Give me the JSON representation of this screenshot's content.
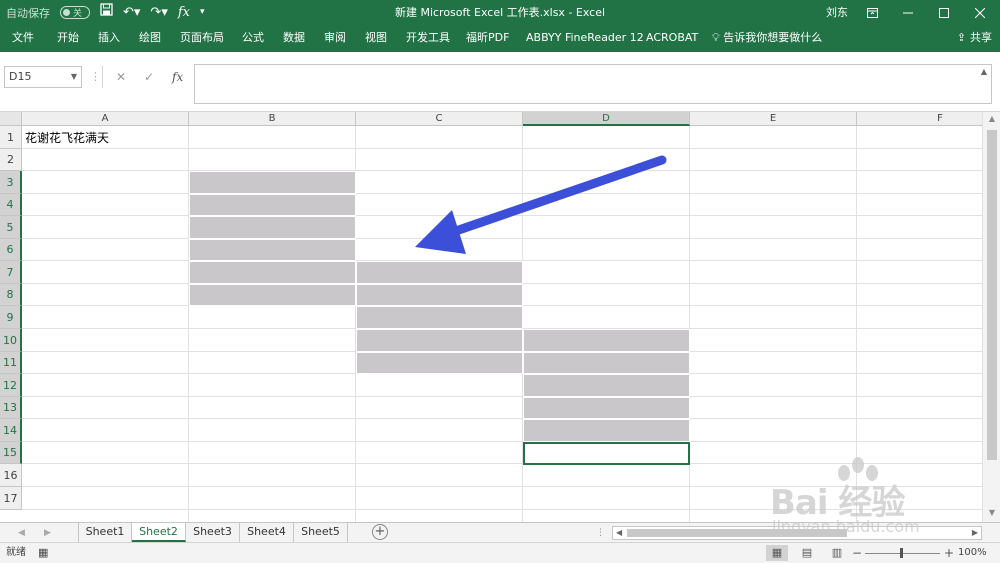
{
  "titlebar": {
    "autosave_label": "自动保存",
    "autosave_state": "关",
    "title": "新建 Microsoft Excel 工作表.xlsx  -  Excel",
    "user": "刘东"
  },
  "ribbon": {
    "tabs": [
      "文件",
      "开始",
      "插入",
      "绘图",
      "页面布局",
      "公式",
      "数据",
      "审阅",
      "视图",
      "开发工具",
      "福昕PDF",
      "ABBYY FineReader 12",
      "ACROBAT"
    ],
    "tell_me": "告诉我你想要做什么",
    "share": "共享"
  },
  "formula_bar": {
    "name_box": "D15",
    "fx_label": "fx",
    "formula": ""
  },
  "grid": {
    "columns": [
      "A",
      "B",
      "C",
      "D",
      "E",
      "F"
    ],
    "selected_column": "D",
    "rows": [
      "1",
      "2",
      "3",
      "4",
      "5",
      "6",
      "7",
      "8",
      "9",
      "10",
      "11",
      "12",
      "13",
      "14",
      "15",
      "16",
      "17"
    ],
    "selected_rows": [
      "3",
      "4",
      "5",
      "6",
      "7",
      "8",
      "9",
      "10",
      "11",
      "12",
      "13",
      "14",
      "15"
    ],
    "cell_a1": "花谢花飞花满天",
    "shaded_fill": "#c9c7ca",
    "active_cell": "D15",
    "arrow_color": "#3b4fd8"
  },
  "sheets": {
    "tabs": [
      "Sheet1",
      "Sheet2",
      "Sheet3",
      "Sheet4",
      "Sheet5"
    ],
    "active": "Sheet2"
  },
  "statusbar": {
    "ready": "就绪",
    "zoom": "100%"
  },
  "watermark": {
    "main": "Bai 经验",
    "sub": "jingyan.baidu.com"
  },
  "theme": {
    "accent": "#217346"
  }
}
